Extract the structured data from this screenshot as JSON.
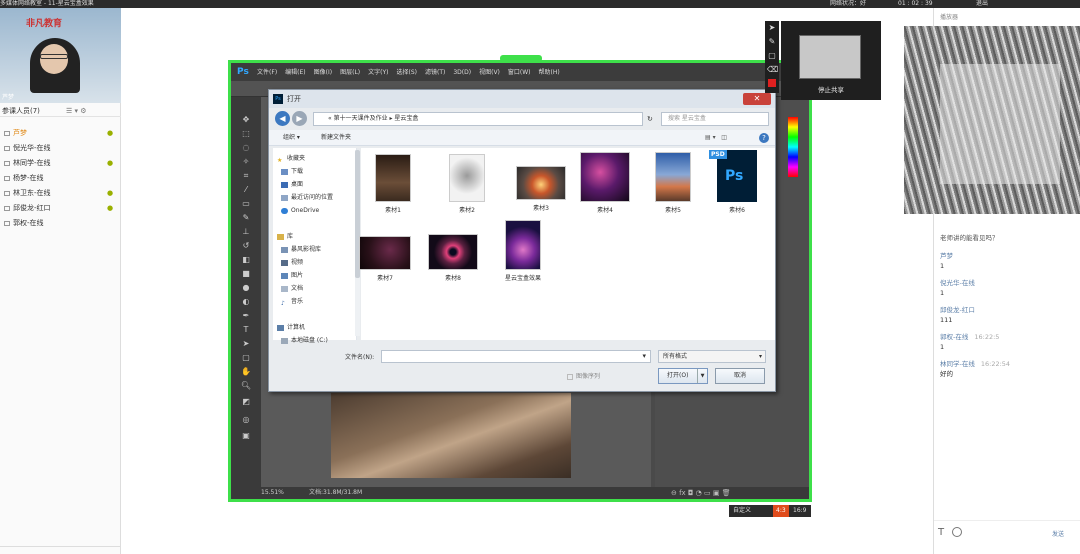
{
  "topbar": {
    "title": "多媒体网络教室 - 11-星云宝盒效果",
    "net": "网络状况：好",
    "time": "01 : 02 : 39",
    "right": "退出"
  },
  "left_panel": {
    "logo": "非凡教育",
    "teacher_name": "芦梦",
    "participants_header": "参课人员(7)",
    "participants": [
      {
        "name": "芦梦",
        "mic": true
      },
      {
        "name": "倪光华-在线",
        "mic": false
      },
      {
        "name": "林同学-在线",
        "mic": true
      },
      {
        "name": "杨梦-在线",
        "mic": false
      },
      {
        "name": "林卫东-在线",
        "mic": true
      },
      {
        "name": "邱俊龙-红口",
        "mic": true
      },
      {
        "name": "郭权-在线",
        "mic": false
      }
    ]
  },
  "photoshop": {
    "logo": "Ps",
    "menu": [
      "文件(F)",
      "编辑(E)",
      "图像(I)",
      "图层(L)",
      "文字(Y)",
      "选择(S)",
      "滤镜(T)",
      "3D(D)",
      "视图(V)",
      "窗口(W)",
      "帮助(H)"
    ],
    "zoom": "15.51%",
    "doc_size": "文档:31.8M/31.8M"
  },
  "open_dialog": {
    "title": "打开",
    "close": "✕",
    "path": "« 第十一天课件及作业 ▸ 星云宝盒",
    "search_placeholder": "搜索 星云宝盒",
    "organize": "组织 ▾",
    "new_folder": "新建文件夹",
    "nav": {
      "favorites": "收藏夹",
      "downloads": "下载",
      "desktop": "桌面",
      "recent": "最近访问的位置",
      "onedrive": "OneDrive",
      "libraries": "库",
      "video_lib": "暴风影视库",
      "videos": "视频",
      "pictures": "图片",
      "documents": "文档",
      "music": "音乐",
      "computer": "计算机",
      "local_disk": "本地磁盘 (C:)"
    },
    "files": [
      {
        "name": "素材1"
      },
      {
        "name": "素材2"
      },
      {
        "name": "素材3"
      },
      {
        "name": "素材4"
      },
      {
        "name": "素材5"
      },
      {
        "name": "素材6",
        "badge": "PSD",
        "glyph": "Ps"
      },
      {
        "name": "素材7"
      },
      {
        "name": "素材8"
      },
      {
        "name": "星云宝盒效果"
      }
    ],
    "filename_label": "文件名(N):",
    "filetype": "所有格式",
    "image_sequence": "图像序列",
    "open": "打开(O)",
    "cancel": "取消"
  },
  "share": {
    "stop_label": "停止共享"
  },
  "ratio": {
    "custom": "自定义",
    "r43": "4:3",
    "r169": "16:9"
  },
  "right_panel": {
    "title": "播放器",
    "chat": [
      {
        "name": "芦梦",
        "time": "",
        "msg": "1"
      },
      {
        "name": "倪光华-在线",
        "time": "",
        "msg": "1"
      },
      {
        "name": "邱俊龙-红口",
        "time": "",
        "msg": "111"
      },
      {
        "name": "郭权-在线",
        "time": "16:22:5",
        "msg": "1"
      },
      {
        "name": "林同学-在线",
        "time": "16:22:54",
        "msg": "好的"
      }
    ],
    "chat_prefix": "老师讲的能看见吗？",
    "send": "发送"
  }
}
